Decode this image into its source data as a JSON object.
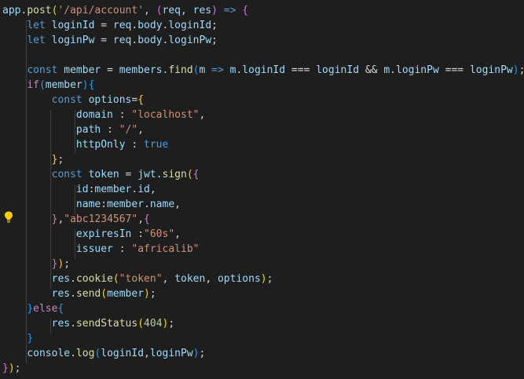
{
  "editor": {
    "lines": [
      [
        {
          "t": "app",
          "c": "var"
        },
        {
          "t": ".",
          "c": "punc"
        },
        {
          "t": "post",
          "c": "fn"
        },
        {
          "t": "(",
          "c": "br1"
        },
        {
          "t": "'/api/account'",
          "c": "str"
        },
        {
          "t": ", ",
          "c": "punc"
        },
        {
          "t": "(",
          "c": "br2"
        },
        {
          "t": "req",
          "c": "var"
        },
        {
          "t": ", ",
          "c": "punc"
        },
        {
          "t": "res",
          "c": "var"
        },
        {
          "t": ")",
          "c": "br2"
        },
        {
          "t": " ",
          "c": "punc"
        },
        {
          "t": "=>",
          "c": "kw"
        },
        {
          "t": " ",
          "c": "punc"
        },
        {
          "t": "{",
          "c": "br2"
        }
      ],
      [
        {
          "t": "    ",
          "c": "punc"
        },
        {
          "t": "let",
          "c": "kw"
        },
        {
          "t": " ",
          "c": "punc"
        },
        {
          "t": "loginId",
          "c": "var"
        },
        {
          "t": " = ",
          "c": "punc"
        },
        {
          "t": "req",
          "c": "var"
        },
        {
          "t": ".",
          "c": "punc"
        },
        {
          "t": "body",
          "c": "var"
        },
        {
          "t": ".",
          "c": "punc"
        },
        {
          "t": "loginId",
          "c": "var"
        },
        {
          "t": ";",
          "c": "punc"
        }
      ],
      [
        {
          "t": "    ",
          "c": "punc"
        },
        {
          "t": "let",
          "c": "kw"
        },
        {
          "t": " ",
          "c": "punc"
        },
        {
          "t": "loginPw",
          "c": "var"
        },
        {
          "t": " = ",
          "c": "punc"
        },
        {
          "t": "req",
          "c": "var"
        },
        {
          "t": ".",
          "c": "punc"
        },
        {
          "t": "body",
          "c": "var"
        },
        {
          "t": ".",
          "c": "punc"
        },
        {
          "t": "loginPw",
          "c": "var"
        },
        {
          "t": ";",
          "c": "punc"
        }
      ],
      [],
      [
        {
          "t": "    ",
          "c": "punc"
        },
        {
          "t": "const",
          "c": "kw"
        },
        {
          "t": " ",
          "c": "punc"
        },
        {
          "t": "member",
          "c": "var"
        },
        {
          "t": " = ",
          "c": "punc"
        },
        {
          "t": "members",
          "c": "var"
        },
        {
          "t": ".",
          "c": "punc"
        },
        {
          "t": "find",
          "c": "fn"
        },
        {
          "t": "(",
          "c": "br3"
        },
        {
          "t": "m",
          "c": "var"
        },
        {
          "t": " ",
          "c": "punc"
        },
        {
          "t": "=>",
          "c": "kw"
        },
        {
          "t": " ",
          "c": "punc"
        },
        {
          "t": "m",
          "c": "var"
        },
        {
          "t": ".",
          "c": "punc"
        },
        {
          "t": "loginId",
          "c": "var"
        },
        {
          "t": " === ",
          "c": "punc"
        },
        {
          "t": "loginId",
          "c": "var"
        },
        {
          "t": " && ",
          "c": "punc"
        },
        {
          "t": "m",
          "c": "var"
        },
        {
          "t": ".",
          "c": "punc"
        },
        {
          "t": "loginPw",
          "c": "var"
        },
        {
          "t": " === ",
          "c": "punc"
        },
        {
          "t": "loginPw",
          "c": "var"
        },
        {
          "t": ")",
          "c": "br3"
        },
        {
          "t": ";",
          "c": "punc"
        }
      ],
      [
        {
          "t": "    ",
          "c": "punc"
        },
        {
          "t": "if",
          "c": "ctrl"
        },
        {
          "t": "(",
          "c": "br3"
        },
        {
          "t": "member",
          "c": "var"
        },
        {
          "t": ")",
          "c": "br3"
        },
        {
          "t": "{",
          "c": "br3"
        }
      ],
      [
        {
          "t": "        ",
          "c": "punc"
        },
        {
          "t": "const",
          "c": "kw"
        },
        {
          "t": " ",
          "c": "punc"
        },
        {
          "t": "options",
          "c": "var"
        },
        {
          "t": "=",
          "c": "punc"
        },
        {
          "t": "{",
          "c": "br1"
        }
      ],
      [
        {
          "t": "            ",
          "c": "punc"
        },
        {
          "t": "domain",
          "c": "var"
        },
        {
          "t": " : ",
          "c": "punc"
        },
        {
          "t": "\"localhost\"",
          "c": "str"
        },
        {
          "t": ",",
          "c": "punc"
        }
      ],
      [
        {
          "t": "            ",
          "c": "punc"
        },
        {
          "t": "path",
          "c": "var"
        },
        {
          "t": " : ",
          "c": "punc"
        },
        {
          "t": "\"/\"",
          "c": "str"
        },
        {
          "t": ",",
          "c": "punc"
        }
      ],
      [
        {
          "t": "            ",
          "c": "punc"
        },
        {
          "t": "httpOnly",
          "c": "var"
        },
        {
          "t": " : ",
          "c": "punc"
        },
        {
          "t": "true",
          "c": "kw"
        }
      ],
      [
        {
          "t": "        ",
          "c": "punc"
        },
        {
          "t": "}",
          "c": "br1"
        },
        {
          "t": ";",
          "c": "punc"
        }
      ],
      [
        {
          "t": "        ",
          "c": "punc"
        },
        {
          "t": "const",
          "c": "kw"
        },
        {
          "t": " ",
          "c": "punc"
        },
        {
          "t": "token",
          "c": "var"
        },
        {
          "t": " = ",
          "c": "punc"
        },
        {
          "t": "jwt",
          "c": "var"
        },
        {
          "t": ".",
          "c": "punc"
        },
        {
          "t": "sign",
          "c": "fn"
        },
        {
          "t": "(",
          "c": "br1"
        },
        {
          "t": "{",
          "c": "br2"
        }
      ],
      [
        {
          "t": "            ",
          "c": "punc"
        },
        {
          "t": "id",
          "c": "var"
        },
        {
          "t": ":",
          "c": "punc"
        },
        {
          "t": "member",
          "c": "var"
        },
        {
          "t": ".",
          "c": "punc"
        },
        {
          "t": "id",
          "c": "var"
        },
        {
          "t": ",",
          "c": "punc"
        }
      ],
      [
        {
          "t": "            ",
          "c": "punc"
        },
        {
          "t": "name",
          "c": "var"
        },
        {
          "t": ":",
          "c": "punc"
        },
        {
          "t": "member",
          "c": "var"
        },
        {
          "t": ".",
          "c": "punc"
        },
        {
          "t": "name",
          "c": "var"
        },
        {
          "t": ",",
          "c": "punc"
        }
      ],
      [
        {
          "t": "        ",
          "c": "punc"
        },
        {
          "t": "}",
          "c": "br2"
        },
        {
          "t": ",",
          "c": "punc"
        },
        {
          "t": "\"abc1234567\"",
          "c": "str"
        },
        {
          "t": ",",
          "c": "punc"
        },
        {
          "t": "{",
          "c": "br2"
        }
      ],
      [
        {
          "t": "            ",
          "c": "punc"
        },
        {
          "t": "expiresIn",
          "c": "var"
        },
        {
          "t": " :",
          "c": "punc"
        },
        {
          "t": "\"60s\"",
          "c": "str"
        },
        {
          "t": ",",
          "c": "punc"
        }
      ],
      [
        {
          "t": "            ",
          "c": "punc"
        },
        {
          "t": "issuer",
          "c": "var"
        },
        {
          "t": " : ",
          "c": "punc"
        },
        {
          "t": "\"africalib\"",
          "c": "str"
        }
      ],
      [
        {
          "t": "        ",
          "c": "punc"
        },
        {
          "t": "}",
          "c": "br2"
        },
        {
          "t": ")",
          "c": "br1"
        },
        {
          "t": ";",
          "c": "punc"
        }
      ],
      [
        {
          "t": "        ",
          "c": "punc"
        },
        {
          "t": "res",
          "c": "var"
        },
        {
          "t": ".",
          "c": "punc"
        },
        {
          "t": "cookie",
          "c": "fn"
        },
        {
          "t": "(",
          "c": "br1"
        },
        {
          "t": "\"token\"",
          "c": "str"
        },
        {
          "t": ", ",
          "c": "punc"
        },
        {
          "t": "token",
          "c": "var"
        },
        {
          "t": ", ",
          "c": "punc"
        },
        {
          "t": "options",
          "c": "var"
        },
        {
          "t": ")",
          "c": "br1"
        },
        {
          "t": ";",
          "c": "punc"
        }
      ],
      [
        {
          "t": "        ",
          "c": "punc"
        },
        {
          "t": "res",
          "c": "var"
        },
        {
          "t": ".",
          "c": "punc"
        },
        {
          "t": "send",
          "c": "fn"
        },
        {
          "t": "(",
          "c": "br1"
        },
        {
          "t": "member",
          "c": "var"
        },
        {
          "t": ")",
          "c": "br1"
        },
        {
          "t": ";",
          "c": "punc"
        }
      ],
      [
        {
          "t": "    ",
          "c": "punc"
        },
        {
          "t": "}",
          "c": "br3"
        },
        {
          "t": "else",
          "c": "ctrl"
        },
        {
          "t": "{",
          "c": "br3"
        }
      ],
      [
        {
          "t": "        ",
          "c": "punc"
        },
        {
          "t": "res",
          "c": "var"
        },
        {
          "t": ".",
          "c": "punc"
        },
        {
          "t": "sendStatus",
          "c": "fn"
        },
        {
          "t": "(",
          "c": "br1"
        },
        {
          "t": "404",
          "c": "num"
        },
        {
          "t": ")",
          "c": "br1"
        },
        {
          "t": ";",
          "c": "punc"
        }
      ],
      [
        {
          "t": "    ",
          "c": "punc"
        },
        {
          "t": "}",
          "c": "br3"
        }
      ],
      [
        {
          "t": "    ",
          "c": "punc"
        },
        {
          "t": "console",
          "c": "var"
        },
        {
          "t": ".",
          "c": "punc"
        },
        {
          "t": "log",
          "c": "fn"
        },
        {
          "t": "(",
          "c": "br3"
        },
        {
          "t": "loginId",
          "c": "var"
        },
        {
          "t": ",",
          "c": "punc"
        },
        {
          "t": "loginPw",
          "c": "var"
        },
        {
          "t": ")",
          "c": "br3"
        },
        {
          "t": ";",
          "c": "punc"
        }
      ],
      [
        {
          "t": "}",
          "c": "br2"
        },
        {
          "t": ")",
          "c": "br1"
        },
        {
          "t": ";",
          "c": "punc"
        }
      ]
    ],
    "colors": {
      "background": "#1e1e1e",
      "keyword": "#569cd6",
      "control": "#c586c0",
      "variable": "#9cdcfe",
      "function": "#dcdcaa",
      "string": "#ce9178",
      "number": "#b5cea8",
      "bracket_gold": "#ffd700",
      "bracket_orchid": "#da70d6",
      "bracket_blue": "#179fff"
    },
    "gutter_icon": "lightbulb-icon"
  }
}
